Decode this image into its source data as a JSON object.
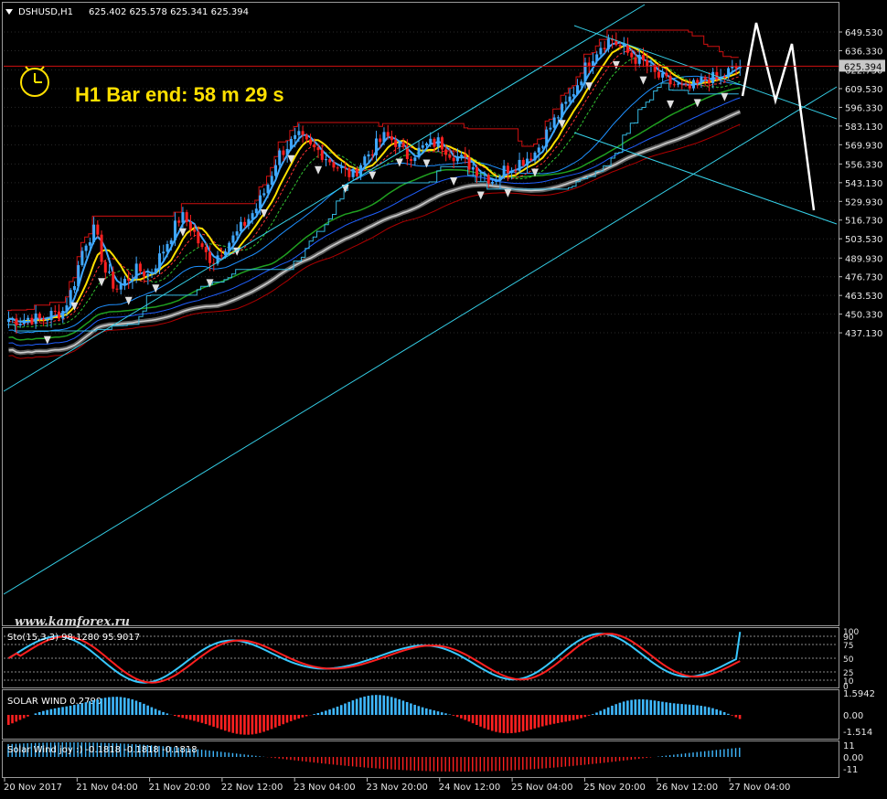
{
  "header": {
    "symbol": "DSHUSD,H1",
    "ohlc": "625.402 625.578 625.341 625.394",
    "timer_text": "H1 Bar end: 58 m 29 s",
    "watermark": "www.kamforex.ru"
  },
  "colors": {
    "background": "#000000",
    "bull_candle": "#3fa8ff",
    "bear_candle": "#ff2020",
    "channel": "#35d0e8",
    "price_line": "#d01010",
    "yellow_ma": "#ffe000",
    "grid": "#2a2a2a"
  },
  "icons": [
    "clock-icon",
    "arrow-up-icon",
    "arrow-down-icon"
  ],
  "chart_data": [
    {
      "type": "candlestick",
      "name": "main",
      "ylim": [
        437.13,
        655.0
      ],
      "y_ticks": [
        "649.530",
        "636.330",
        "622.730",
        "609.530",
        "596.330",
        "583.130",
        "569.930",
        "556.330",
        "543.130",
        "529.930",
        "516.730",
        "503.530",
        "489.930",
        "476.730",
        "463.530",
        "450.330",
        "437.130"
      ],
      "current_price": "625.394",
      "x_ticks": [
        "20 Nov 2017",
        "21 Nov 04:00",
        "21 Nov 20:00",
        "22 Nov 12:00",
        "23 Nov 04:00",
        "23 Nov 20:00",
        "24 Nov 12:00",
        "25 Nov 04:00",
        "25 Nov 20:00",
        "26 Nov 12:00",
        "27 Nov 04:00"
      ],
      "price_path": [
        447,
        446,
        448,
        446,
        450,
        452,
        470,
        500,
        510,
        480,
        468,
        475,
        482,
        478,
        490,
        505,
        520,
        512,
        495,
        488,
        498,
        505,
        515,
        525,
        540,
        562,
        570,
        575,
        568,
        565,
        558,
        552,
        548,
        560,
        568,
        576,
        572,
        562,
        565,
        570,
        572,
        565,
        560,
        555,
        550,
        545,
        552,
        556,
        560,
        565,
        578,
        590,
        600,
        615,
        630,
        640,
        645,
        638,
        632,
        628,
        620,
        615,
        612,
        608,
        612,
        618,
        615,
        622,
        625
      ]
    },
    {
      "type": "line",
      "name": "oscillator",
      "label": "Sto(15,3,3) 98.1280 95.9017",
      "ylim": [
        0,
        100
      ],
      "y_ticks": [
        "100",
        "90",
        "75",
        "50",
        "25",
        "10",
        "0"
      ]
    },
    {
      "type": "bar",
      "name": "SOLAR WIND",
      "label": "SOLAR WIND 0.2790",
      "ylim": [
        -1.514,
        1.5942
      ],
      "y_ticks": [
        "1.5942",
        "0.00",
        "-1.514"
      ]
    },
    {
      "type": "bar",
      "name": "Solar Wind joy",
      "label": "Solar Wind joy :) -0.1818 -0.1818 -0.1818",
      "ylim": [
        -11,
        11
      ],
      "y_ticks": [
        "11",
        "0.00",
        "-11"
      ]
    }
  ]
}
